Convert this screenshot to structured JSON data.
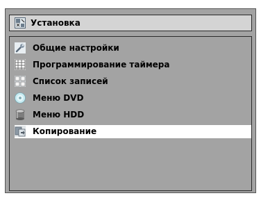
{
  "title_bar": {
    "icon": "setup-icon",
    "label": "Установка"
  },
  "menu": {
    "selected_index": 5,
    "items": [
      {
        "label": "Общие настройки",
        "icon": "wrench-icon"
      },
      {
        "label": "Программирование таймера",
        "icon": "timer-grid-icon"
      },
      {
        "label": "Список записей",
        "icon": "recording-list-icon"
      },
      {
        "label": "Меню DVD",
        "icon": "dvd-disc-icon"
      },
      {
        "label": "Меню HDD",
        "icon": "hdd-cylinder-icon"
      },
      {
        "label": "Копирование",
        "icon": "copy-icon"
      }
    ]
  },
  "colors": {
    "panel_background": "#a3a3a3",
    "title_background": "#d4d4d4",
    "selected_background": "#ffffff",
    "text": "#000000"
  }
}
